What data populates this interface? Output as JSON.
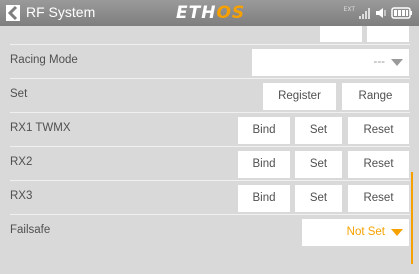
{
  "header": {
    "title": "RF System",
    "logo_part1": "ETH",
    "logo_part2": "OS",
    "ext_label": "EXT",
    "back_icon": "chevron-left-icon",
    "signal_icon": "signal-bars-icon",
    "volume_icon": "speaker-icon",
    "battery_icon": "battery-icon"
  },
  "rows": {
    "racing_mode": {
      "label": "Racing Mode",
      "value": "---"
    },
    "set": {
      "label": "Set",
      "register": "Register",
      "range": "Range"
    },
    "rx1": {
      "label": "RX1  TWMX",
      "bind": "Bind",
      "set": "Set",
      "reset": "Reset"
    },
    "rx2": {
      "label": "RX2",
      "bind": "Bind",
      "set": "Set",
      "reset": "Reset"
    },
    "rx3": {
      "label": "RX3",
      "bind": "Bind",
      "set": "Set",
      "reset": "Reset"
    },
    "failsafe": {
      "label": "Failsafe",
      "value": "Not Set"
    }
  },
  "colors": {
    "accent": "#f7a100",
    "header_bg": "#8c8c8c",
    "content_bg": "#d9d9d9",
    "button_bg": "#ffffff",
    "text": "#505050"
  }
}
